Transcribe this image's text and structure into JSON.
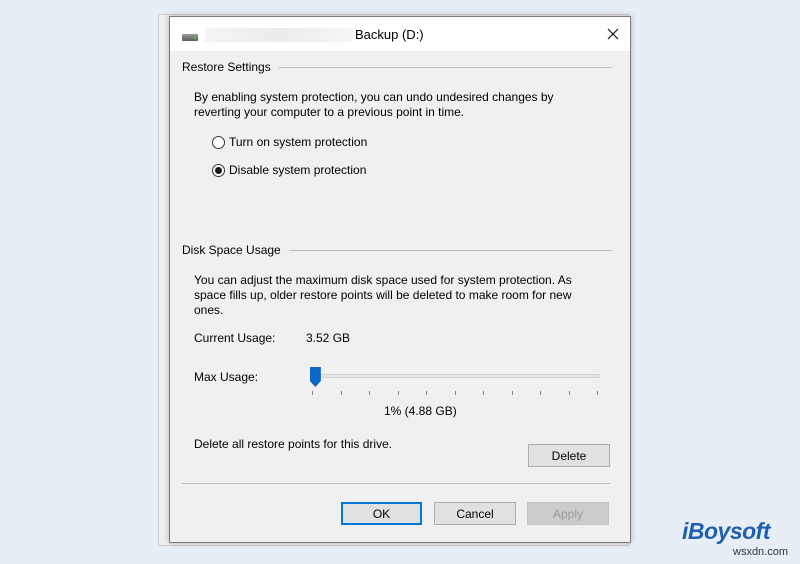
{
  "window": {
    "title": "Backup (D:)",
    "close_icon": "close-icon",
    "drive_icon": "drive-icon"
  },
  "restore_settings": {
    "group_label": "Restore Settings",
    "description": "By enabling system protection, you can undo undesired changes by reverting your computer to a previous point in time.",
    "options": [
      {
        "label": "Turn on system protection",
        "checked": false
      },
      {
        "label": "Disable system protection",
        "checked": true
      }
    ]
  },
  "disk_space": {
    "group_label": "Disk Space Usage",
    "description": "You can adjust the maximum disk space used for system protection. As space fills up, older restore points will be deleted to make room for new ones.",
    "current_usage_label": "Current Usage:",
    "current_usage_value": "3.52 GB",
    "max_usage_label": "Max Usage:",
    "max_usage_fraction": 0.01,
    "max_usage_display": "1% (4.88 GB)",
    "delete_text": "Delete all restore points for this drive.",
    "delete_button": "Delete"
  },
  "footer": {
    "ok": "OK",
    "cancel": "Cancel",
    "apply": "Apply"
  },
  "branding": {
    "logo": "iBoysoft",
    "watermark": "wsxdn.com"
  },
  "colors": {
    "accent": "#0078d7",
    "slider_thumb": "#0a66c8",
    "background": "#e7eef6"
  }
}
